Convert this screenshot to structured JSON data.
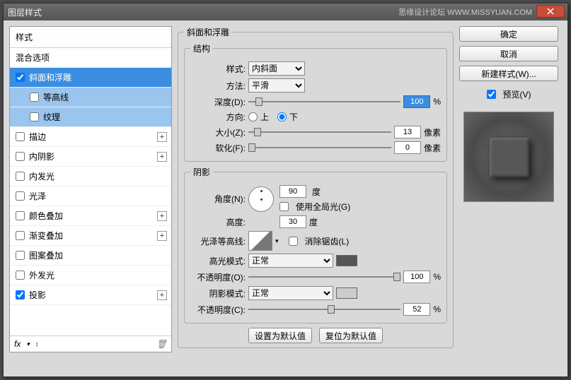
{
  "window": {
    "title": "图层样式",
    "watermark": "思缘设计论坛  WWW.MISSYUAN.COM"
  },
  "sidebar": {
    "header": "样式",
    "blend": "混合选项",
    "items": [
      {
        "label": "斜面和浮雕",
        "checked": true,
        "selected": true,
        "plus": false,
        "sub": false
      },
      {
        "label": "等高线",
        "checked": false,
        "selected": false,
        "plus": false,
        "sub": true
      },
      {
        "label": "纹理",
        "checked": false,
        "selected": false,
        "plus": false,
        "sub": true
      },
      {
        "label": "描边",
        "checked": false,
        "plus": true
      },
      {
        "label": "内阴影",
        "checked": false,
        "plus": true
      },
      {
        "label": "内发光",
        "checked": false,
        "plus": false
      },
      {
        "label": "光泽",
        "checked": false,
        "plus": false
      },
      {
        "label": "颜色叠加",
        "checked": false,
        "plus": true
      },
      {
        "label": "渐变叠加",
        "checked": false,
        "plus": true
      },
      {
        "label": "图案叠加",
        "checked": false,
        "plus": false
      },
      {
        "label": "外发光",
        "checked": false,
        "plus": false
      },
      {
        "label": "投影",
        "checked": true,
        "plus": true
      }
    ],
    "fx": "fx"
  },
  "bevel": {
    "legend": "斜面和浮雕",
    "struct": "结构",
    "style_lbl": "样式:",
    "style_val": "内斜面",
    "method_lbl": "方法:",
    "method_val": "平滑",
    "depth_lbl": "深度(D):",
    "depth_val": "100",
    "pct": "%",
    "dir_lbl": "方向:",
    "up": "上",
    "down": "下",
    "size_lbl": "大小(Z):",
    "size_val": "13",
    "px": "像素",
    "soften_lbl": "软化(F):",
    "soften_val": "0",
    "shadow": "阴影",
    "angle_lbl": "角度(N):",
    "angle_val": "90",
    "deg": "度",
    "global": "使用全局光(G)",
    "alt_lbl": "高度:",
    "alt_val": "30",
    "gloss_lbl": "光泽等高线:",
    "aa": "消除锯齿(L)",
    "hmode_lbl": "高光模式:",
    "hmode_val": "正常",
    "hop_lbl": "不透明度(O):",
    "hop_val": "100",
    "smode_lbl": "阴影模式:",
    "smode_val": "正常",
    "sop_lbl": "不透明度(C):",
    "sop_val": "52",
    "set_default": "设置为默认值",
    "reset_default": "复位为默认值"
  },
  "buttons": {
    "ok": "确定",
    "cancel": "取消",
    "newstyle": "新建样式(W)...",
    "preview": "预览(V)"
  }
}
